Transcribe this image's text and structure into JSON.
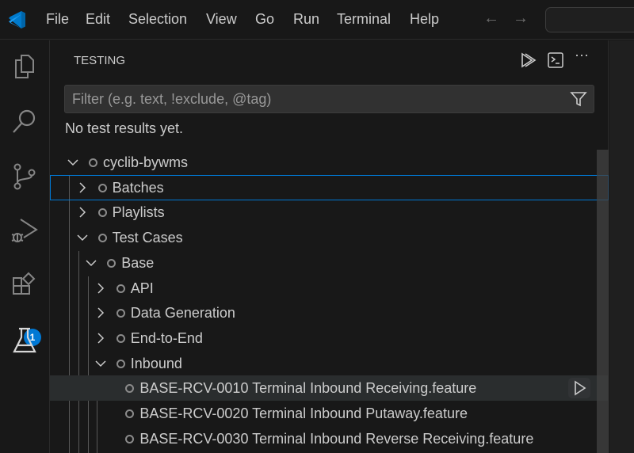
{
  "menu": [
    "File",
    "Edit",
    "Selection",
    "View",
    "Go",
    "Run",
    "Terminal",
    "Help"
  ],
  "activity_badge": "1",
  "sidebar": {
    "title": "TESTING",
    "filter_placeholder": "Filter (e.g. text, !exclude, @tag)",
    "filter_value": "",
    "no_results": "No test results yet."
  },
  "tree": [
    {
      "label": "cyclib-bywms",
      "level": 0,
      "state": "expanded"
    },
    {
      "label": "Batches",
      "level": 1,
      "state": "collapsed",
      "selected": true
    },
    {
      "label": "Playlists",
      "level": 1,
      "state": "collapsed"
    },
    {
      "label": "Test Cases",
      "level": 1,
      "state": "expanded"
    },
    {
      "label": "Base",
      "level": 2,
      "state": "expanded"
    },
    {
      "label": "API",
      "level": 3,
      "state": "collapsed"
    },
    {
      "label": "Data Generation",
      "level": 3,
      "state": "collapsed"
    },
    {
      "label": "End-to-End",
      "level": 3,
      "state": "collapsed"
    },
    {
      "label": "Inbound",
      "level": 3,
      "state": "expanded"
    },
    {
      "label": "BASE-RCV-0010 Terminal Inbound Receiving.feature",
      "level": 4,
      "state": "leaf",
      "hovered": true
    },
    {
      "label": "BASE-RCV-0020 Terminal Inbound Putaway.feature",
      "level": 4,
      "state": "leaf"
    },
    {
      "label": "BASE-RCV-0030 Terminal Inbound Reverse Receiving.feature",
      "level": 4,
      "state": "leaf"
    }
  ]
}
